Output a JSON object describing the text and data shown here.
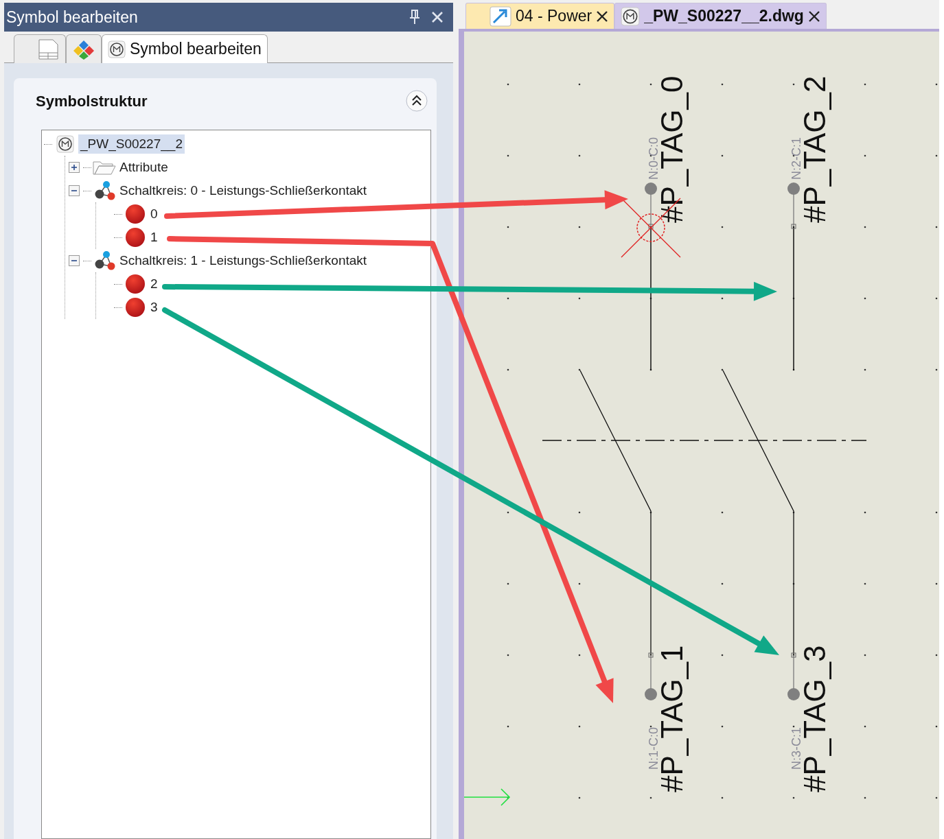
{
  "panel": {
    "title": "Symbol bearbeiten",
    "tabs": [
      {
        "kind": "page",
        "selected": false
      },
      {
        "kind": "colors",
        "selected": false
      },
      {
        "kind": "symbol",
        "label": "Symbol bearbeiten",
        "selected": true
      }
    ],
    "section": {
      "title": "Symbolstruktur",
      "expanded": true
    },
    "tree": [
      {
        "label": "_PW_S00227__2",
        "kind": "symbol",
        "selected": true,
        "children": [
          {
            "label": "Attribute",
            "kind": "folder",
            "expanded": false,
            "selected": false
          },
          {
            "label": "Schaltkreis: 0 - Leistungs-Schließerkontakt",
            "kind": "circuit",
            "expanded": true,
            "selected": false,
            "children": [
              {
                "label": "0",
                "kind": "connection",
                "selected": false
              },
              {
                "label": "1",
                "kind": "connection",
                "selected": false
              }
            ]
          },
          {
            "label": "Schaltkreis: 1 - Leistungs-Schließerkontakt",
            "kind": "circuit",
            "expanded": true,
            "selected": false,
            "children": [
              {
                "label": "2",
                "kind": "connection",
                "selected": false
              },
              {
                "label": "3",
                "kind": "connection",
                "selected": false
              }
            ]
          }
        ]
      }
    ]
  },
  "document_tabs": [
    {
      "label": "04 - Power",
      "kind": "page",
      "selected": false
    },
    {
      "label": "_PW_S00227__2.dwg",
      "kind": "symbol",
      "selected": true
    }
  ],
  "canvas": {
    "poles": [
      {
        "terminals": [
          {
            "tag": "#P_TAG_0",
            "connection": "N:0-C:0",
            "crossed": true
          },
          {
            "tag": "#P_TAG_1",
            "connection": "N:1-C:0",
            "crossed": false
          }
        ]
      },
      {
        "terminals": [
          {
            "tag": "#P_TAG_2",
            "connection": "N:2-C:1",
            "crossed": false
          },
          {
            "tag": "#P_TAG_3",
            "connection": "N:3-C:1",
            "crossed": false
          }
        ]
      }
    ]
  },
  "annotations": [
    {
      "color": "#f04848"
    },
    {
      "color": "#f04848"
    },
    {
      "color": "#10a888"
    },
    {
      "color": "#10a888"
    }
  ]
}
